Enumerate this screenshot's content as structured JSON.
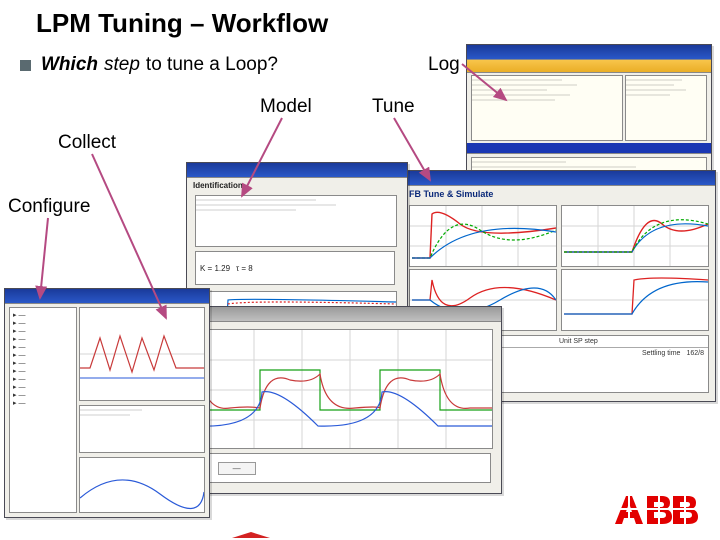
{
  "title": "LPM Tuning – Workflow",
  "question": {
    "word1": "Which",
    "word2": "step",
    "rest": "to tune a Loop?"
  },
  "labels": {
    "log": "Log",
    "model": "Model",
    "tune": "Tune",
    "collect": "Collect",
    "configure": "Configure"
  },
  "logo_alt": "ABB",
  "workflow_order": [
    "Configure",
    "Collect",
    "Model",
    "Tune",
    "Log"
  ],
  "colors": {
    "arrow": "#b54a82",
    "log_text": "#3a3a3a",
    "abb_red": "#e20000",
    "bar_yellow": "#f0b93a",
    "bar_blue": "#1a3a9a"
  },
  "windows": {
    "configure_tree": "Project explorer / tree view",
    "collect_trend": "Realtime trend collection",
    "model_id": "Model Identification and evaluation",
    "tune_sim": "FB Tune & Simulate",
    "log_status": "Loop tuning log / status window"
  }
}
